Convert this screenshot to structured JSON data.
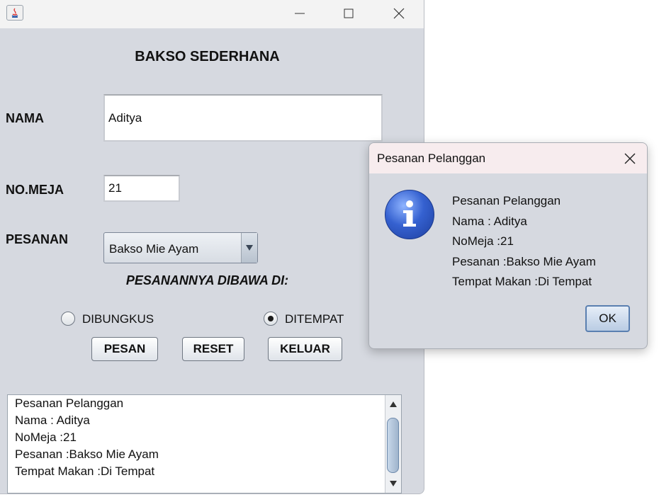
{
  "main_window": {
    "heading": "BAKSO SEDERHANA",
    "labels": {
      "nama": "NAMA",
      "no_meja": "NO.MEJA",
      "pesanan": "PESANAN"
    },
    "fields": {
      "nama_value": "Aditya",
      "no_meja_value": "21",
      "pesanan_selected": "Bakso Mie Ayam"
    },
    "takeaway_heading": "PESANANNYA DIBAWA DI:",
    "radios": [
      {
        "label": "DIBUNGKUS",
        "selected": false
      },
      {
        "label": "DITEMPAT",
        "selected": true
      }
    ],
    "buttons": {
      "pesan": "PESAN",
      "reset": "RESET",
      "keluar": "KELUAR"
    },
    "output_lines": [
      "Pesanan Pelanggan",
      "Nama : Aditya",
      "NoMeja :21",
      "Pesanan :Bakso Mie Ayam",
      "Tempat Makan :Di Tempat"
    ]
  },
  "dialog": {
    "title": "Pesanan Pelanggan",
    "icon": "info-icon",
    "message_lines": [
      "Pesanan Pelanggan",
      "Nama : Aditya",
      "NoMeja :21",
      "Pesanan :Bakso Mie Ayam",
      "Tempat Makan :Di Tempat"
    ],
    "ok_label": "OK"
  }
}
